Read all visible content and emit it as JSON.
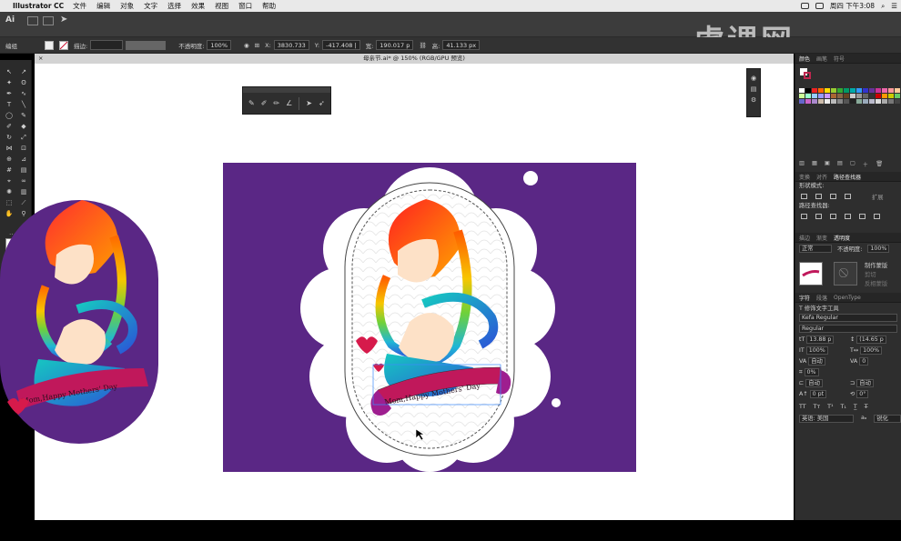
{
  "menubar": {
    "app_name": "Illustrator CC",
    "items": [
      "文件",
      "编辑",
      "对象",
      "文字",
      "选择",
      "效果",
      "视图",
      "窗口",
      "帮助"
    ],
    "clock": "周四 下午3:08"
  },
  "appbar": {
    "logo": "Ai"
  },
  "control": {
    "selection_label": "编组",
    "stroke_label": "描边:",
    "opacity_label": "不透明度:",
    "opacity_value": "100%",
    "x_label": "X:",
    "x_value": "3830.733",
    "y_label": "Y:",
    "y_value": "-417.408 |",
    "w_label": "宽:",
    "w_value": "190.017 p",
    "h_label": "高:",
    "h_value": "41.133 px"
  },
  "document": {
    "tab_title": "母亲节.ai* @ 150% (RGB/GPU 预览)"
  },
  "artwork": {
    "banner_text": "Mom,Happy Mothers' Day",
    "left_banner_text": "Mom,Happy Mothers' Day"
  },
  "right_panel": {
    "tabs_top": [
      "颜色",
      "画笔",
      "符号"
    ],
    "tabs_mid": [
      "变换",
      "对齐",
      "路径查找器"
    ],
    "shape_mode_label": "形状模式:",
    "expand_button": "扩展",
    "pathfinder_label": "路径查找器:",
    "tabs_trans": [
      "描边",
      "渐变",
      "透明度"
    ],
    "blend_mode": "正常",
    "opacity_label": "不透明度:",
    "opacity_value": "100%",
    "mask_button": "制作蒙版",
    "clip_label": "剪切",
    "invert_label": "反相蒙版",
    "tabs_char": [
      "字符",
      "段落",
      "OpenType"
    ],
    "touch_type": "修饰文字工具",
    "font_name": "Kefa Regular",
    "font_style": "Regular",
    "font_size": "13.88 p",
    "leading": "(14.65 p",
    "scale_v": "100%",
    "scale_h": "100%",
    "kerning": "自动",
    "tracking": "0",
    "rotation": "0%",
    "auto_1": "自动",
    "auto_2": "自动",
    "baseline": "0 pt",
    "baseline_rot": "0°",
    "language_label": "英语: 美国",
    "aa_label": "锐化"
  },
  "watermark": {
    "text": "虎课网"
  },
  "colors": {
    "artboard": "#5a2785",
    "canvas": "#ffffff",
    "banner": "#c0185b",
    "heart": "#d61a4b"
  }
}
